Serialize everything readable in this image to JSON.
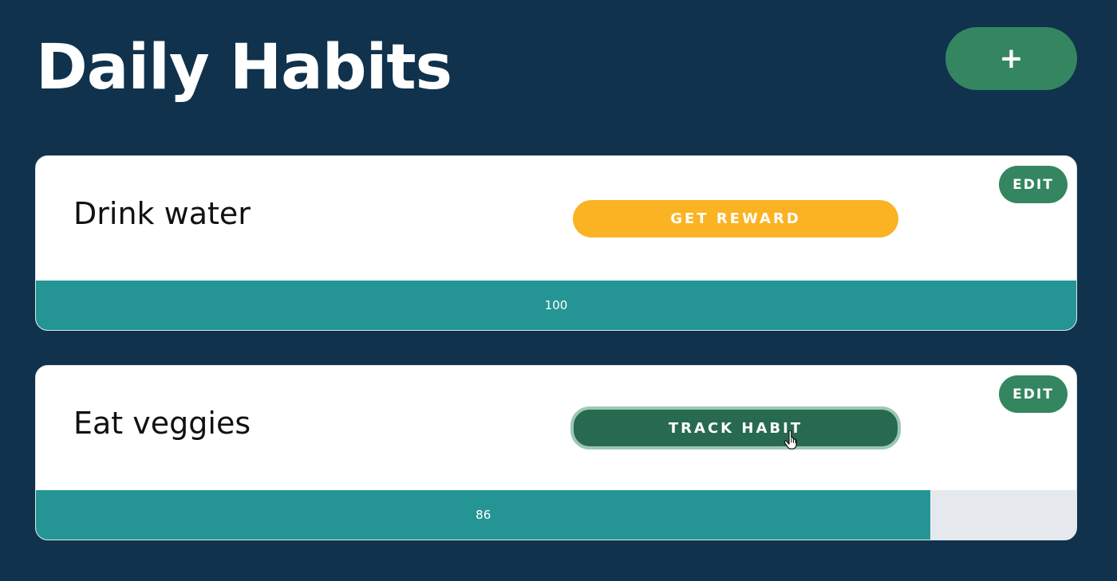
{
  "header": {
    "title": "Daily Habits",
    "add_label": "+"
  },
  "colors": {
    "background": "#10324d",
    "primary_green": "#348660",
    "reward_yellow": "#fbb323",
    "track_green": "#286a50",
    "progress_teal": "#249594",
    "progress_empty": "#e5e9ed"
  },
  "habits": [
    {
      "name": "Drink water",
      "edit_label": "EDIT",
      "action_label": "GET REWARD",
      "action_type": "reward",
      "progress": 100,
      "progress_label": "100"
    },
    {
      "name": "Eat veggies",
      "edit_label": "EDIT",
      "action_label": "TRACK HABIT",
      "action_type": "track",
      "progress": 86,
      "progress_label": "86"
    }
  ]
}
